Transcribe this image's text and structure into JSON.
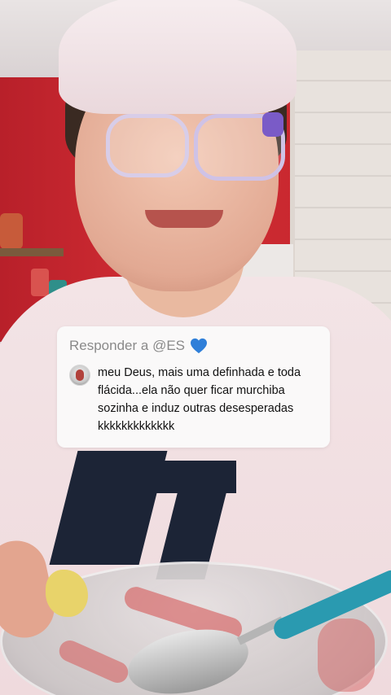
{
  "reply_card": {
    "header_label": "Responder a @ES",
    "header_icon": "blue-heart-icon",
    "heart_color": "#2f7fd9",
    "comment_text": "meu Deus, mais uma definhada e toda flácida...ela não quer ficar murchiba sozinha e induz outras desesperadas kkkkkkkkkkkkk",
    "avatar_icon": "commenter-avatar"
  }
}
